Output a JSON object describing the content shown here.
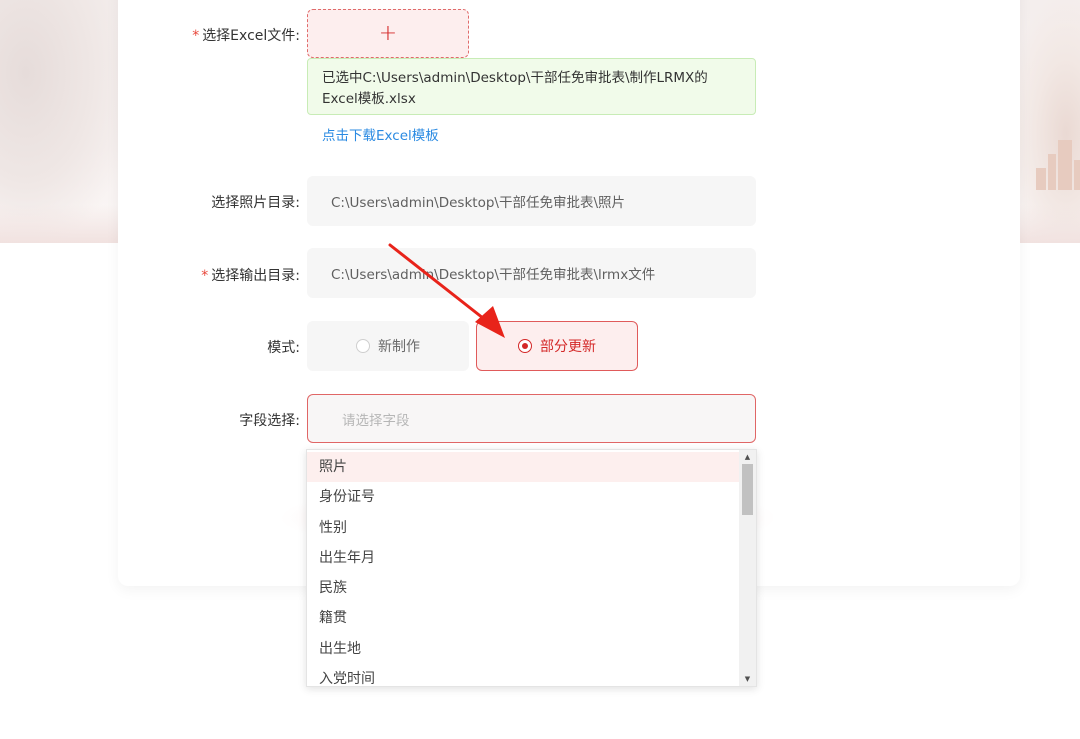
{
  "form": {
    "excel_label": "选择Excel文件:",
    "required_mark": "*",
    "upload_plus": "+",
    "file_selected_text": "已选中C:\\Users\\admin\\Desktop\\干部任免审批表\\制作LRMX的Excel模板.xlsx",
    "download_template_link": "点击下载Excel模板",
    "photo_dir_label": "选择照片目录:",
    "photo_dir_value": "C:\\Users\\admin\\Desktop\\干部任免审批表\\照片",
    "output_dir_label": "选择输出目录:",
    "output_dir_value": "C:\\Users\\admin\\Desktop\\干部任免审批表\\lrmx文件",
    "mode_label": "模式:",
    "mode_options": [
      {
        "label": "新制作",
        "selected": false
      },
      {
        "label": "部分更新",
        "selected": true
      }
    ],
    "field_label": "字段选择:",
    "field_placeholder": "请选择字段"
  },
  "dropdown": {
    "items": [
      "照片",
      "身份证号",
      "性别",
      "出生年月",
      "民族",
      "籍贯",
      "出生地",
      "入党时间"
    ],
    "highlighted_index": 0
  },
  "colors": {
    "accent": "#d42828",
    "required": "#e8463a",
    "link": "#2a8ae2",
    "success_bg": "#f1fbea",
    "annotation_arrow": "#e8231a"
  },
  "icons": {
    "upload": "plus-icon",
    "scroll_up": "triangle-up-icon",
    "scroll_down": "triangle-down-icon",
    "annotation": "red-arrow-annotation"
  }
}
